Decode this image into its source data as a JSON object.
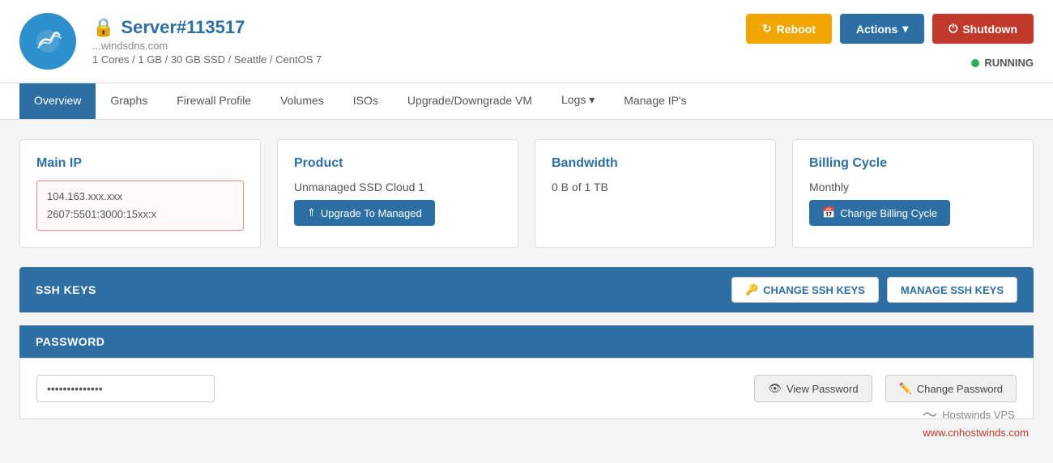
{
  "header": {
    "logo_alt": "Hostwinds Logo",
    "server_title": "Server#113517",
    "server_subtitle": "...windsdns.com",
    "server_specs": "1 Cores / 1 GB / 30 GB SSD / Seattle / CentOS 7",
    "status": "RUNNING",
    "btn_reboot": "Reboot",
    "btn_actions": "Actions",
    "btn_shutdown": "Shutdown"
  },
  "nav": {
    "tabs": [
      {
        "label": "Overview",
        "active": true
      },
      {
        "label": "Graphs",
        "active": false
      },
      {
        "label": "Firewall Profile",
        "active": false
      },
      {
        "label": "Volumes",
        "active": false
      },
      {
        "label": "ISOs",
        "active": false
      },
      {
        "label": "Upgrade/Downgrade VM",
        "active": false
      },
      {
        "label": "Logs",
        "active": false
      },
      {
        "label": "Manage IP's",
        "active": false
      }
    ]
  },
  "cards": {
    "main_ip": {
      "title": "Main IP",
      "ip4": "104.163.xxx.xxx",
      "ip6": "2607:5501:3000:15xx:x"
    },
    "product": {
      "title": "Product",
      "name": "Unmanaged SSD Cloud 1",
      "btn_upgrade": "Upgrade To Managed"
    },
    "bandwidth": {
      "title": "Bandwidth",
      "usage": "0 B of 1 TB"
    },
    "billing": {
      "title": "Billing Cycle",
      "cycle": "Monthly",
      "btn_change": "Change Billing Cycle"
    }
  },
  "ssh_keys": {
    "title": "SSH KEYS",
    "btn_change": "CHANGE SSH KEYS",
    "btn_manage": "MANAGE SSH KEYS"
  },
  "password": {
    "title": "PASSWORD",
    "value": "**************",
    "btn_view": "View Password",
    "btn_change": "Change Password"
  },
  "watermark": {
    "brand": "Hostwinds VPS",
    "url": "www.cnhostwinds.com"
  }
}
